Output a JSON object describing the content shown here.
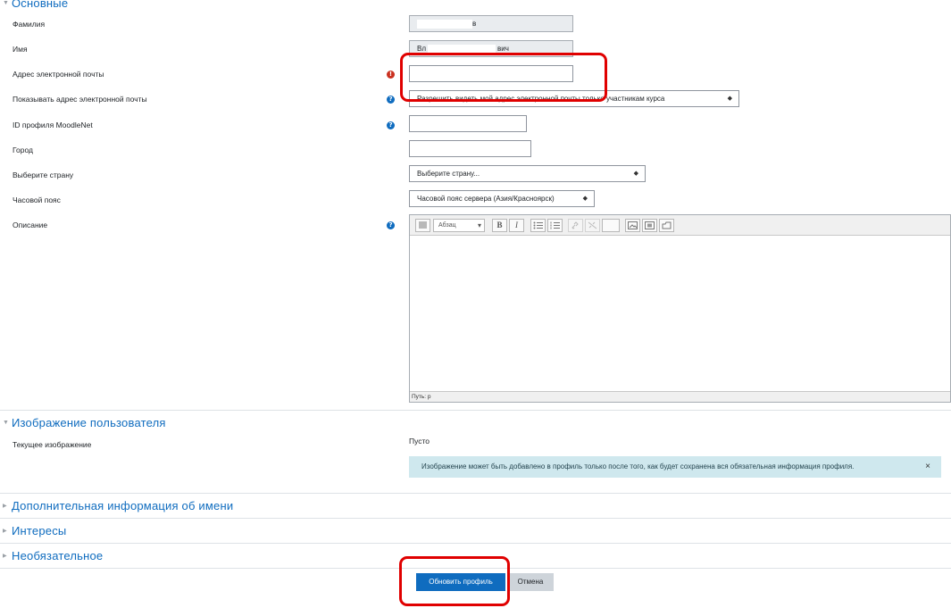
{
  "sections": {
    "general": "Основные",
    "user_picture": "Изображение пользователя",
    "additional_names": "Дополнительная информация об имени",
    "interests": "Интересы",
    "optional": "Необязательное"
  },
  "fields": {
    "lastname": {
      "label": "Фамилия",
      "value": "в"
    },
    "firstname": {
      "label": "Имя",
      "value_start": "Вл",
      "value_end": "вич"
    },
    "email": {
      "label": "Адрес электронной почты",
      "value": ""
    },
    "maildisplay": {
      "label": "Показывать адрес электронной почты",
      "value": "Разрешить видеть мой адрес электронной почты только участникам курса"
    },
    "moodlenet": {
      "label": "ID профиля MoodleNet",
      "value": ""
    },
    "city": {
      "label": "Город",
      "value": ""
    },
    "country": {
      "label": "Выберите страну",
      "value": "Выберите страну..."
    },
    "timezone": {
      "label": "Часовой пояс",
      "value": "Часовой пояс сервера (Азия/Красноярск)"
    },
    "description": {
      "label": "Описание",
      "paragraph_format": "Абзац",
      "path": "Путь: p"
    }
  },
  "picture": {
    "current_label": "Текущее изображение",
    "current_value": "Пусто",
    "alert": "Изображение может быть добавлено в профиль только после того, как будет сохранена вся обязательная информация профиля."
  },
  "buttons": {
    "submit": "Обновить профиль",
    "cancel": "Отмена"
  },
  "glyphs": {
    "required": "!",
    "help": "?",
    "close": "×",
    "select_arrow": "◆",
    "collapsed": "▶",
    "expanded": "▼",
    "bold": "B",
    "italic": "I",
    "dropdown": "▾"
  },
  "icons": [
    "required-icon",
    "help-icon",
    "close-icon",
    "select-arrow-icon",
    "collapse-arrow-icon",
    "expand-arrow-icon",
    "toggle-toolbar-icon",
    "bullet-list-icon",
    "numbered-list-icon",
    "link-icon",
    "unlink-icon",
    "image-icon",
    "media-icon",
    "file-icon"
  ],
  "colors": {
    "accent": "#0f6cbf",
    "required": "#ca3120",
    "annotation": "#e00000",
    "alert_bg": "#cfe8ee"
  }
}
